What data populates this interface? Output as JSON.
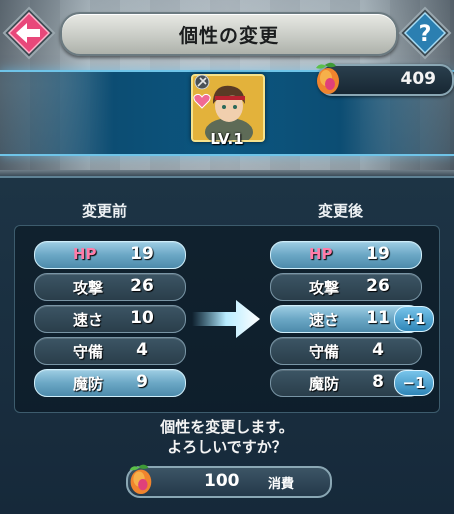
{
  "header": {
    "title": "個性の変更",
    "back_icon": "back-arrow-icon",
    "help_icon": "help-question-icon",
    "help_label": "?"
  },
  "orbs": {
    "count": "409",
    "icon": "orb-icon"
  },
  "unit": {
    "level": "LV.1",
    "icons": [
      "favorite-heart-icon",
      "weapon-type-icon"
    ]
  },
  "before": {
    "header": "変更前",
    "stats": [
      {
        "name": "HP",
        "value": "19",
        "highlight": true
      },
      {
        "name": "攻撃",
        "value": "26",
        "highlight": false
      },
      {
        "name": "速さ",
        "value": "10",
        "highlight": false
      },
      {
        "name": "守備",
        "value": "4",
        "highlight": false
      },
      {
        "name": "魔防",
        "value": "9",
        "highlight": true
      }
    ]
  },
  "after": {
    "header": "変更後",
    "stats": [
      {
        "name": "HP",
        "value": "19",
        "highlight": true
      },
      {
        "name": "攻撃",
        "value": "26",
        "highlight": false
      },
      {
        "name": "速さ",
        "value": "11",
        "highlight": true,
        "delta": "+1"
      },
      {
        "name": "守備",
        "value": "4",
        "highlight": false
      },
      {
        "name": "魔防",
        "value": "8",
        "highlight": false,
        "delta": "−1"
      }
    ]
  },
  "confirm": {
    "line1": "個性を変更します。",
    "line2": "よろしいですか？"
  },
  "cost": {
    "value": "100",
    "label": "消費"
  },
  "colors": {
    "accent_blue": "#6fc4e8",
    "hp_pink": "#ff7ca8",
    "back_pink": "#e8487a"
  }
}
